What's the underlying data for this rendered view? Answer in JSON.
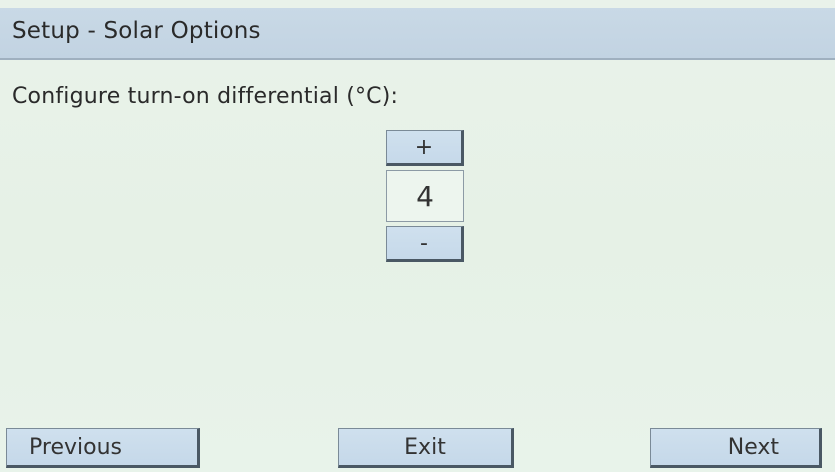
{
  "header": {
    "title": "Setup - Solar Options"
  },
  "main": {
    "prompt": "Configure turn-on differential (°C):",
    "stepper": {
      "increment_label": "+",
      "value": "4",
      "decrement_label": "-"
    }
  },
  "footer": {
    "previous_label": "Previous",
    "exit_label": "Exit",
    "next_label": "Next"
  }
}
